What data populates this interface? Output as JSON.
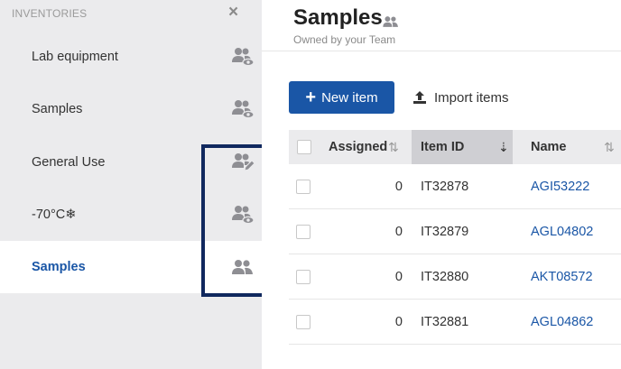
{
  "sidebar": {
    "header": "INVENTORIES",
    "close_glyph": "×",
    "items": [
      {
        "label": "Lab equipment",
        "icon": "team-view-icon",
        "active": false
      },
      {
        "label": "Samples",
        "icon": "team-view-icon",
        "active": false
      },
      {
        "label": "General Use",
        "icon": "team-edit-icon",
        "active": false
      },
      {
        "label": "-70°C❄",
        "icon": "team-view-icon",
        "active": false
      },
      {
        "label": "Samples",
        "icon": "team-icon",
        "active": true
      }
    ]
  },
  "main": {
    "title": "Samples",
    "title_icon": "team-icon",
    "subtitle": "Owned by your Team",
    "new_item_label": "New item",
    "import_items_label": "Import items"
  },
  "table": {
    "columns": [
      {
        "key": "assigned",
        "label": "Assigned",
        "sort_glyph": "⇅"
      },
      {
        "key": "item_id",
        "label": "Item ID",
        "sort_glyph": "⇣"
      },
      {
        "key": "name",
        "label": "Name",
        "sort_glyph": "⇅"
      }
    ],
    "rows": [
      {
        "assigned": "0",
        "item_id": "IT32878",
        "name": "AGI53222"
      },
      {
        "assigned": "0",
        "item_id": "IT32879",
        "name": "AGL04802"
      },
      {
        "assigned": "0",
        "item_id": "IT32880",
        "name": "AKT08572"
      },
      {
        "assigned": "0",
        "item_id": "IT32881",
        "name": "AGL04862"
      }
    ]
  },
  "colors": {
    "accent": "#1a56a6",
    "highlight_box": "#10285e",
    "sidebar_bg": "#ebebed"
  }
}
